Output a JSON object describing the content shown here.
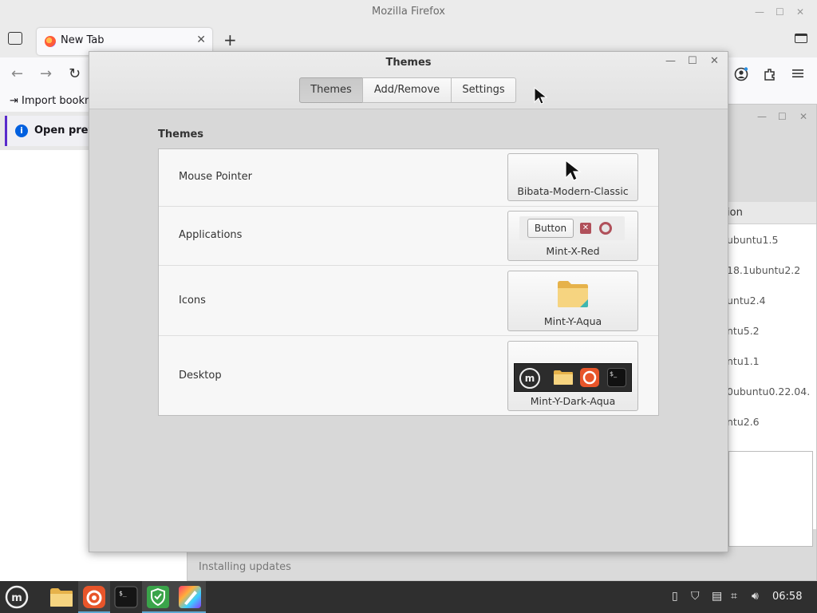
{
  "firefox": {
    "window_title": "Mozilla Firefox",
    "tab_label": "New Tab",
    "bookmark_text": "Import bookm",
    "info_text": "Open previ"
  },
  "update_manager": {
    "column_header": "ion",
    "versions": [
      "ubuntu1.5",
      "18.1ubuntu2.2",
      "untu2.4",
      "ntu5.2",
      "ntu1.1",
      "0ubuntu0.22.04.",
      "ntu2.6"
    ],
    "status": "Installing updates"
  },
  "themes_dialog": {
    "title": "Themes",
    "tabs": [
      {
        "label": "Themes",
        "active": true
      },
      {
        "label": "Add/Remove",
        "active": false
      },
      {
        "label": "Settings",
        "active": false
      }
    ],
    "section_title": "Themes",
    "rows": [
      {
        "label": "Mouse Pointer",
        "value": "Bibata-Modern-Classic"
      },
      {
        "label": "Applications",
        "value": "Mint-X-Red",
        "preview_button": "Button"
      },
      {
        "label": "Icons",
        "value": "Mint-Y-Aqua"
      },
      {
        "label": "Desktop",
        "value": "Mint-Y-Dark-Aqua"
      }
    ],
    "accent_color": "#b0505a"
  },
  "taskbar": {
    "clock": "06:58",
    "apps": [
      "menu-icon",
      "files-icon",
      "firefox-icon",
      "terminal-icon",
      "shield-icon",
      "themes-icon"
    ]
  }
}
